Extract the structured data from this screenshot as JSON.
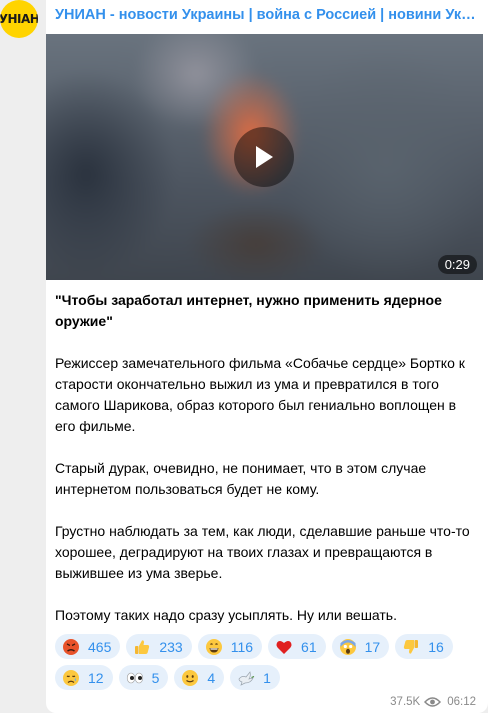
{
  "channel": {
    "avatar_text": "УНІАН",
    "title": "УНИАН - новости Украины | война с Россией | новини України"
  },
  "video": {
    "duration": "0:29"
  },
  "post": {
    "paragraphs": [
      "\"Чтобы заработал интернет, нужно применить ядерное оружие\"",
      "Режиссер замечательного фильма «Собачье сердце» Бортко к старости окончательно выжил из ума и превратился в того самого Шарикова, образ которого был гениально воплощен в его фильме.",
      "Старый дурак, очевидно, не понимает, что в этом случае интернетом пользоваться будет не кому.",
      "Грустно наблюдать за тем, как люди, сделавшие раньше что-то хорошее, деградируют на твоих глазах и превращаются в выжившее из ума зверье.",
      "Поэтому таких надо сразу усыплять. Ну или вешать."
    ]
  },
  "reactions": [
    {
      "icon": "angry-face-icon",
      "count": "465"
    },
    {
      "icon": "thumbs-up-icon",
      "count": "233"
    },
    {
      "icon": "grinning-face-icon",
      "count": "116"
    },
    {
      "icon": "red-heart-icon",
      "count": "61"
    },
    {
      "icon": "screaming-face-icon",
      "count": "17"
    },
    {
      "icon": "thumbs-down-icon",
      "count": "16"
    },
    {
      "icon": "crying-face-icon",
      "count": "12"
    },
    {
      "icon": "eyes-icon",
      "count": "5"
    },
    {
      "icon": "slightly-smiling-face-icon",
      "count": "4"
    },
    {
      "icon": "dove-icon",
      "count": "1"
    }
  ],
  "meta": {
    "views": "37.5K",
    "time": "06:12"
  },
  "colors": {
    "accent": "#3390ec",
    "avatar_bg": "#ffd400",
    "reaction_bg": "#e6f0fb",
    "chat_bg": "#eeeeee"
  }
}
